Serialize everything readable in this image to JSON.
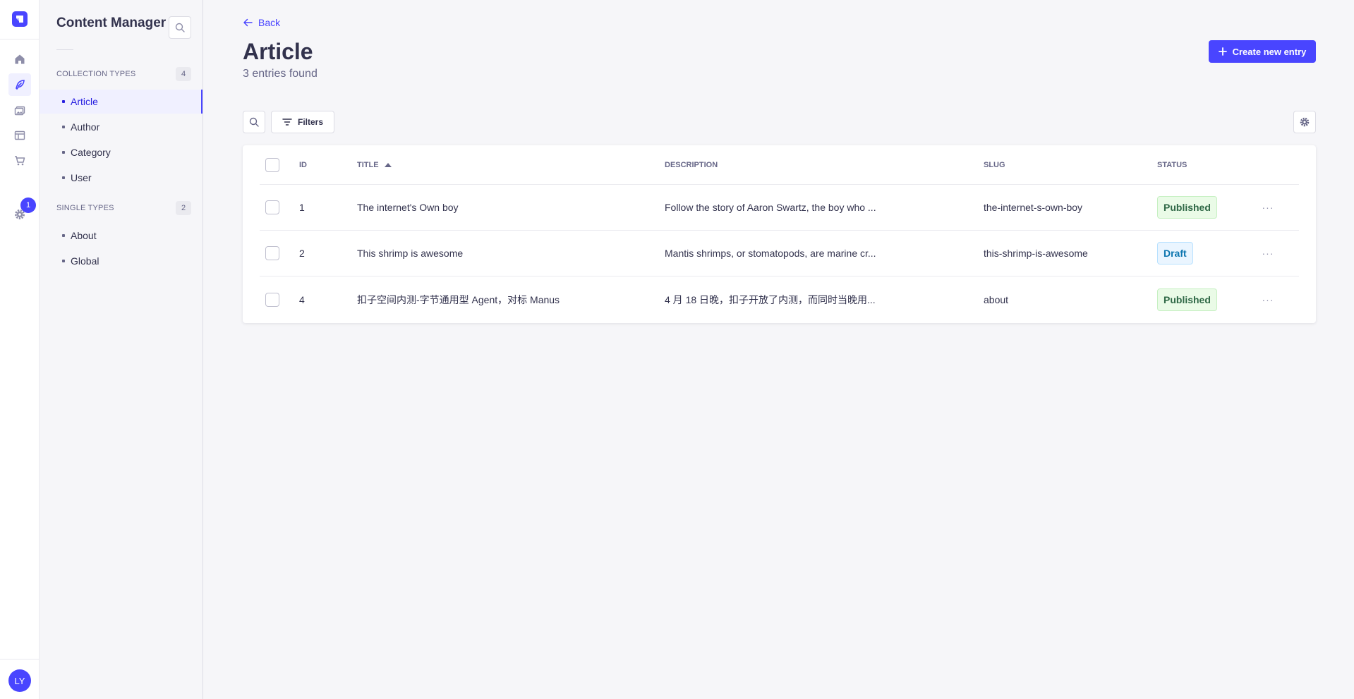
{
  "rail": {
    "avatar_initials": "LY",
    "settings_badge": "1"
  },
  "subnav": {
    "title": "Content Manager",
    "collection_types": {
      "label": "COLLECTION TYPES",
      "count": "4",
      "items": [
        {
          "label": "Article"
        },
        {
          "label": "Author"
        },
        {
          "label": "Category"
        },
        {
          "label": "User"
        }
      ]
    },
    "single_types": {
      "label": "SINGLE TYPES",
      "count": "2",
      "items": [
        {
          "label": "About"
        },
        {
          "label": "Global"
        }
      ]
    }
  },
  "header": {
    "back_label": "Back",
    "title": "Article",
    "subtitle": "3 entries found",
    "create_label": "Create new entry"
  },
  "toolbar": {
    "filters_label": "Filters"
  },
  "table": {
    "columns": {
      "id": "ID",
      "title": "TITLE",
      "description": "DESCRIPTION",
      "slug": "SLUG",
      "status": "STATUS"
    },
    "rows": [
      {
        "id": "1",
        "title": "The internet's Own boy",
        "description": "Follow the story of Aaron Swartz, the boy who ...",
        "slug": "the-internet-s-own-boy",
        "status": "Published"
      },
      {
        "id": "2",
        "title": "This shrimp is awesome",
        "description": "Mantis shrimps, or stomatopods, are marine cr...",
        "slug": "this-shrimp-is-awesome",
        "status": "Draft"
      },
      {
        "id": "4",
        "title": "扣子空间内测-字节通用型 Agent，对标 Manus",
        "description": "4 月 18 日晚，扣子开放了内测，而同时当晚用...",
        "slug": "about",
        "status": "Published"
      }
    ],
    "more_label": "···"
  },
  "colors": {
    "primary": "#4945ff",
    "published_bg": "#eafbe7",
    "published_text": "#2f6846",
    "draft_bg": "#eaf5ff",
    "draft_text": "#0c75af"
  }
}
